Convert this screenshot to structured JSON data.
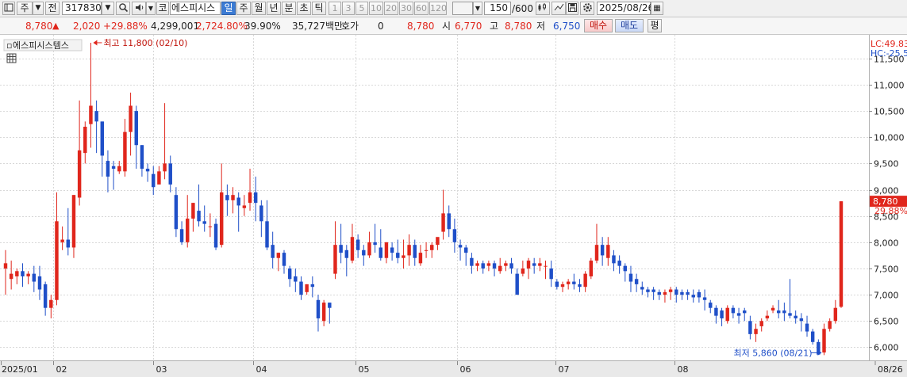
{
  "toolbar": {
    "market_label": "주",
    "prev_label": "전",
    "code": "317830",
    "market_code_label": "코",
    "stock_name": "에스피시스",
    "periods": [
      "일",
      "주",
      "월",
      "년",
      "분",
      "초",
      "틱"
    ],
    "active_period": "일",
    "intervals": [
      "1",
      "3",
      "5",
      "10",
      "20",
      "30",
      "60",
      "120"
    ],
    "count": "150",
    "count_total": "/600",
    "date": "2025/08/26"
  },
  "quote": {
    "price": "8,780",
    "change": "2,020",
    "change_pct": "+29.88%",
    "volume": "4,299,001",
    "volume_pct": "2,724.80%",
    "turnover_pct": "39.90%",
    "amount": "35,727백만",
    "hoga_label": "호가",
    "hoga": "0",
    "hoga_price": "8,780",
    "open_label": "시",
    "open": "6,770",
    "high_label": "고",
    "high": "8,780",
    "low_label": "저",
    "low": "6,750",
    "buy_label": "매수",
    "sell_label": "매도",
    "avg_label": "평"
  },
  "chart_header": {
    "name": "에스피시스템스",
    "lc": "LC:49.83",
    "hc": "HC:-25.5"
  },
  "chart_data": {
    "type": "candlestick",
    "y_ticks": [
      "11,500",
      "11,000",
      "10,500",
      "10,000",
      "9,500",
      "9,000",
      "8,500",
      "8,000",
      "7,500",
      "7,000",
      "6,500",
      "6,000"
    ],
    "ylim": [
      5750,
      11950
    ],
    "x_ticks": [
      "2025/01",
      "02",
      "03",
      "04",
      "05",
      "06",
      "07",
      "08",
      "08/26"
    ],
    "annotations": {
      "high": "최고 11,800 (02/10)",
      "low": "최저 5,860 (08/21)",
      "current": "8,780",
      "current_pct": "29.88%"
    },
    "colors": {
      "up": "#e0261c",
      "down": "#1f4fc8"
    },
    "candles": [
      [
        7500,
        7850,
        7600,
        7000
      ],
      [
        7300,
        7650,
        7400,
        7100
      ],
      [
        7350,
        7500,
        7450,
        7200
      ],
      [
        7450,
        7600,
        7350,
        7150
      ],
      [
        7350,
        7450,
        7400,
        7200
      ],
      [
        7400,
        7550,
        7250,
        7050
      ],
      [
        7350,
        7550,
        7100,
        6900
      ],
      [
        7200,
        7250,
        6750,
        6600
      ],
      [
        6750,
        7000,
        6900,
        6550
      ],
      [
        6900,
        8950,
        8400,
        6800
      ],
      [
        8000,
        8300,
        8050,
        7850
      ],
      [
        8050,
        8650,
        7900,
        7750
      ],
      [
        7900,
        8900,
        8900,
        7700
      ],
      [
        8850,
        10700,
        9750,
        8700
      ],
      [
        9700,
        10300,
        10200,
        9500
      ],
      [
        10250,
        11800,
        10600,
        9800
      ],
      [
        10500,
        10700,
        10300,
        9700
      ],
      [
        10300,
        10300,
        9650,
        9250
      ],
      [
        9550,
        9750,
        9250,
        8950
      ],
      [
        9450,
        9550,
        9400,
        9000
      ],
      [
        9350,
        9550,
        9450,
        9300
      ],
      [
        9350,
        10350,
        10100,
        9250
      ],
      [
        10100,
        10850,
        10600,
        9650
      ],
      [
        10500,
        10600,
        9850,
        9400
      ],
      [
        9850,
        9850,
        9400,
        9250
      ],
      [
        9400,
        9500,
        9350,
        9150
      ],
      [
        9300,
        9450,
        9050,
        8900
      ],
      [
        9100,
        9450,
        9350,
        9150
      ],
      [
        9350,
        10650,
        9500,
        9200
      ],
      [
        9500,
        9650,
        9100,
        8950
      ],
      [
        8900,
        9050,
        8250,
        8100
      ],
      [
        8250,
        8400,
        8000,
        7950
      ],
      [
        8000,
        8900,
        8450,
        7900
      ],
      [
        8450,
        8750,
        8750,
        8200
      ],
      [
        8600,
        9100,
        8400,
        8300
      ],
      [
        8400,
        8700,
        8350,
        8200
      ],
      [
        8300,
        8550,
        8300,
        8100
      ],
      [
        8350,
        8450,
        7900,
        7850
      ],
      [
        7950,
        9500,
        8950,
        7900
      ],
      [
        8900,
        9100,
        8800,
        8500
      ],
      [
        8800,
        9050,
        8900,
        8550
      ],
      [
        8850,
        8950,
        8700,
        8200
      ],
      [
        8650,
        8900,
        8700,
        8500
      ],
      [
        8750,
        9400,
        8950,
        8600
      ],
      [
        8950,
        9250,
        8750,
        8400
      ],
      [
        8700,
        8800,
        8400,
        8100
      ],
      [
        8400,
        8800,
        7900,
        7850
      ],
      [
        7950,
        8200,
        7700,
        7500
      ],
      [
        7700,
        7800,
        7800,
        7450
      ],
      [
        7800,
        7850,
        7550,
        7400
      ],
      [
        7500,
        7550,
        7300,
        7150
      ],
      [
        7350,
        7500,
        7250,
        7050
      ],
      [
        7250,
        7350,
        7000,
        6900
      ],
      [
        7050,
        7200,
        7200,
        7000
      ],
      [
        7200,
        7350,
        7150,
        6950
      ],
      [
        6900,
        7000,
        6550,
        6300
      ],
      [
        6500,
        6900,
        6850,
        6400
      ],
      [
        6850,
        6850,
        6750,
        6450
      ],
      [
        7400,
        8400,
        7950,
        7300
      ],
      [
        7950,
        8350,
        7800,
        7600
      ],
      [
        7850,
        7950,
        7700,
        7350
      ],
      [
        7650,
        8350,
        8100,
        7600
      ],
      [
        8050,
        8150,
        7850,
        7700
      ],
      [
        7850,
        7950,
        7750,
        7550
      ],
      [
        7750,
        8200,
        8000,
        7700
      ],
      [
        8000,
        8350,
        7950,
        7800
      ],
      [
        7900,
        8250,
        7700,
        7650
      ],
      [
        7700,
        8000,
        8000,
        7600
      ],
      [
        7900,
        8000,
        7800,
        7650
      ],
      [
        7800,
        8050,
        7700,
        7600
      ],
      [
        7700,
        8050,
        7750,
        7500
      ],
      [
        7750,
        8150,
        7950,
        7550
      ],
      [
        7950,
        8050,
        7700,
        7550
      ],
      [
        7600,
        7950,
        7800,
        7550
      ],
      [
        7850,
        8000,
        7850,
        7700
      ],
      [
        7850,
        8000,
        7950,
        7700
      ],
      [
        7950,
        8050,
        8100,
        7850
      ],
      [
        8200,
        9000,
        8550,
        8050
      ],
      [
        8550,
        8700,
        8250,
        8100
      ],
      [
        8250,
        8450,
        8000,
        7800
      ],
      [
        7950,
        8050,
        7900,
        7650
      ],
      [
        7900,
        7950,
        7800,
        7550
      ],
      [
        7700,
        7800,
        7550,
        7400
      ],
      [
        7550,
        7650,
        7600,
        7450
      ],
      [
        7600,
        7650,
        7500,
        7400
      ],
      [
        7550,
        7650,
        7600,
        7450
      ],
      [
        7600,
        7650,
        7500,
        7350
      ],
      [
        7450,
        7700,
        7550,
        7400
      ],
      [
        7550,
        7650,
        7600,
        7450
      ],
      [
        7600,
        7700,
        7500,
        7400
      ],
      [
        7400,
        7500,
        7000,
        7000
      ],
      [
        7400,
        7650,
        7500,
        7350
      ],
      [
        7500,
        7700,
        7650,
        7300
      ],
      [
        7600,
        7700,
        7550,
        7400
      ],
      [
        7550,
        7700,
        7600,
        7450
      ],
      [
        7550,
        7650,
        7550,
        7300
      ],
      [
        7500,
        7650,
        7300,
        7150
      ],
      [
        7250,
        7300,
        7150,
        7100
      ],
      [
        7150,
        7250,
        7200,
        7050
      ],
      [
        7200,
        7300,
        7250,
        7100
      ],
      [
        7250,
        7400,
        7200,
        7100
      ],
      [
        7200,
        7300,
        7150,
        7050
      ],
      [
        7150,
        7450,
        7400,
        7050
      ],
      [
        7350,
        7700,
        7650,
        7300
      ],
      [
        7650,
        8350,
        7950,
        7600
      ],
      [
        7950,
        8100,
        7750,
        7550
      ],
      [
        7700,
        8100,
        7950,
        7550
      ],
      [
        7750,
        7850,
        7600,
        7450
      ],
      [
        7650,
        7750,
        7550,
        7400
      ],
      [
        7550,
        7600,
        7450,
        7250
      ],
      [
        7400,
        7550,
        7250,
        7050
      ],
      [
        7300,
        7400,
        7200,
        7050
      ],
      [
        7150,
        7250,
        7100,
        7000
      ],
      [
        7100,
        7150,
        7050,
        6950
      ],
      [
        7100,
        7150,
        7050,
        6900
      ],
      [
        7050,
        7100,
        7000,
        6900
      ],
      [
        7000,
        7100,
        7050,
        6850
      ],
      [
        7050,
        7150,
        7100,
        6900
      ],
      [
        7100,
        7150,
        7000,
        6850
      ],
      [
        7050,
        7100,
        7000,
        6900
      ],
      [
        7050,
        7100,
        7000,
        6900
      ],
      [
        7000,
        7100,
        6950,
        6850
      ],
      [
        7050,
        7100,
        6950,
        6850
      ],
      [
        6950,
        7100,
        6900,
        6700
      ],
      [
        6850,
        6900,
        6750,
        6650
      ],
      [
        6750,
        6800,
        6600,
        6450
      ],
      [
        6700,
        6750,
        6550,
        6400
      ],
      [
        6500,
        6800,
        6750,
        6450
      ],
      [
        6750,
        6800,
        6650,
        6550
      ],
      [
        6650,
        6750,
        6600,
        6450
      ],
      [
        6700,
        6750,
        6650,
        6500
      ],
      [
        6500,
        6600,
        6250,
        6150
      ],
      [
        6250,
        6450,
        6350,
        6100
      ],
      [
        6400,
        6550,
        6500,
        6300
      ],
      [
        6550,
        6700,
        6600,
        6500
      ],
      [
        6700,
        6800,
        6750,
        6650
      ],
      [
        6700,
        6900,
        6650,
        6550
      ],
      [
        6700,
        6850,
        6650,
        6500
      ],
      [
        6650,
        7300,
        6600,
        6550
      ],
      [
        6600,
        6700,
        6550,
        6450
      ],
      [
        6550,
        6650,
        6500,
        6300
      ],
      [
        6450,
        6600,
        6300,
        6200
      ],
      [
        6300,
        6350,
        6100,
        6050
      ],
      [
        6100,
        6150,
        5860,
        5860
      ],
      [
        5900,
        6450,
        6350,
        5850
      ],
      [
        6350,
        6550,
        6500,
        6300
      ],
      [
        6500,
        6900,
        6750,
        6450
      ],
      [
        6770,
        8780,
        8780,
        6750
      ]
    ]
  }
}
